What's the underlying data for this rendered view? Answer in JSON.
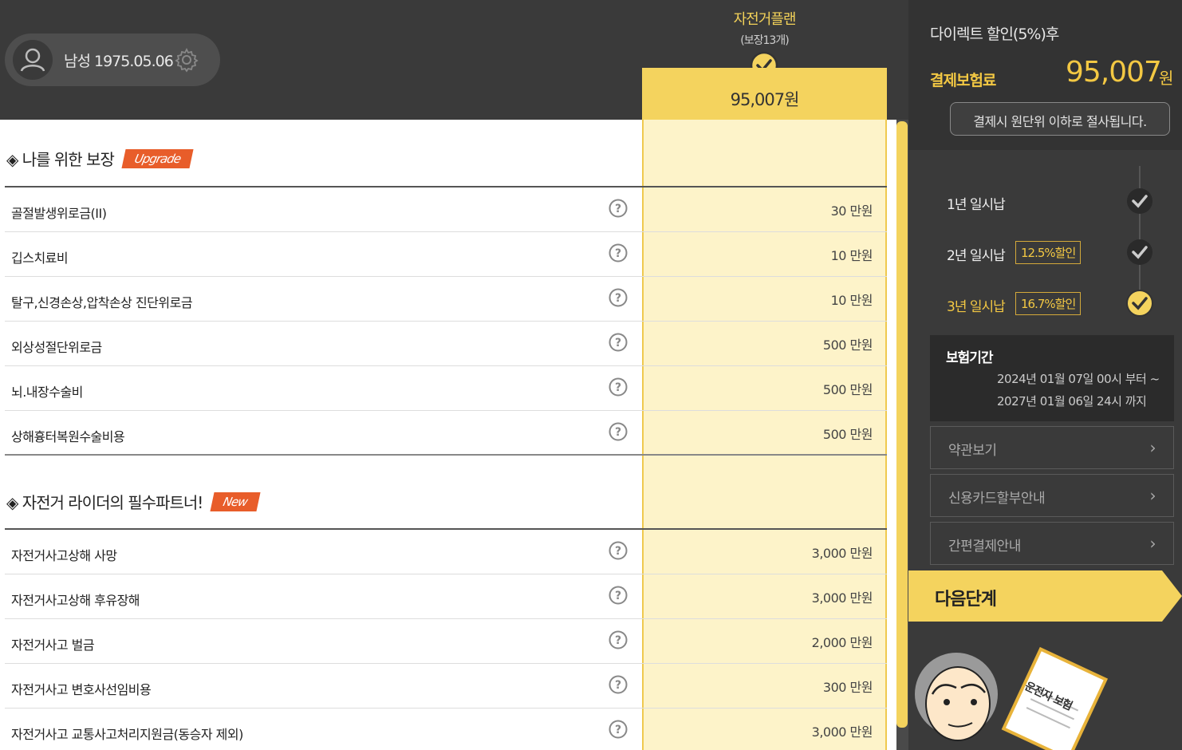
{
  "header": {
    "profile_text": "남성 1975.05.06",
    "plan_title": "자전거플랜",
    "plan_subtitle": "(보장13개)",
    "plan_price": "95,007원"
  },
  "sections": [
    {
      "title": "◈ 나를 위한 보장",
      "tag": "Upgrade",
      "rows": [
        {
          "label": "골절발생위로금(II)",
          "value": "30 만원"
        },
        {
          "label": "깁스치료비",
          "value": "10 만원"
        },
        {
          "label": "탈구,신경손상,압착손상 진단위로금",
          "value": "10 만원"
        },
        {
          "label": "외상성절단위로금",
          "value": "500 만원"
        },
        {
          "label": "뇌.내장수술비",
          "value": "500 만원"
        },
        {
          "label": "상해흉터복원수술비용",
          "value": "500 만원"
        }
      ]
    },
    {
      "title": "◈ 자전거 라이더의 필수파트너!",
      "tag": "New",
      "rows": [
        {
          "label": "자전거사고상해 사망",
          "value": "3,000 만원"
        },
        {
          "label": "자전거사고상해 후유장해",
          "value": "3,000 만원"
        },
        {
          "label": "자전거사고 벌금",
          "value": "2,000 만원"
        },
        {
          "label": "자전거사고 변호사선임비용",
          "value": "300 만원"
        },
        {
          "label": "자전거사고 교통사고처리지원금(동승자 제외)",
          "value": "3,000 만원"
        }
      ]
    }
  ],
  "sidebar": {
    "discount_title": "다이렉트 할인(5%)후",
    "pay_label": "결제보험료",
    "pay_amount": "95,007",
    "pay_unit": "원",
    "tooltip": "결제시 원단위 이하로 절사됩니다.",
    "options": [
      {
        "label": "1년 일시납",
        "badge": "",
        "selected": false
      },
      {
        "label": "2년 일시납",
        "badge": "12.5%할인",
        "selected": false
      },
      {
        "label": "3년 일시납",
        "badge": "16.7%할인",
        "selected": true
      }
    ],
    "period": {
      "title": "보험기간",
      "line1": "2024년 01월 07일 00시 부터 ~",
      "line2": "2027년 01월 06일 24시 까지"
    },
    "links": [
      "약관보기",
      "신용카드할부안내",
      "간편결제안내"
    ],
    "next_label": "다음단계",
    "illustration_text": "운전자 보험"
  },
  "colors": {
    "accent": "#f4d35e",
    "accent_light": "#fdf3c9",
    "tag": "#e85d2a",
    "dark": "#3a3a3a"
  }
}
